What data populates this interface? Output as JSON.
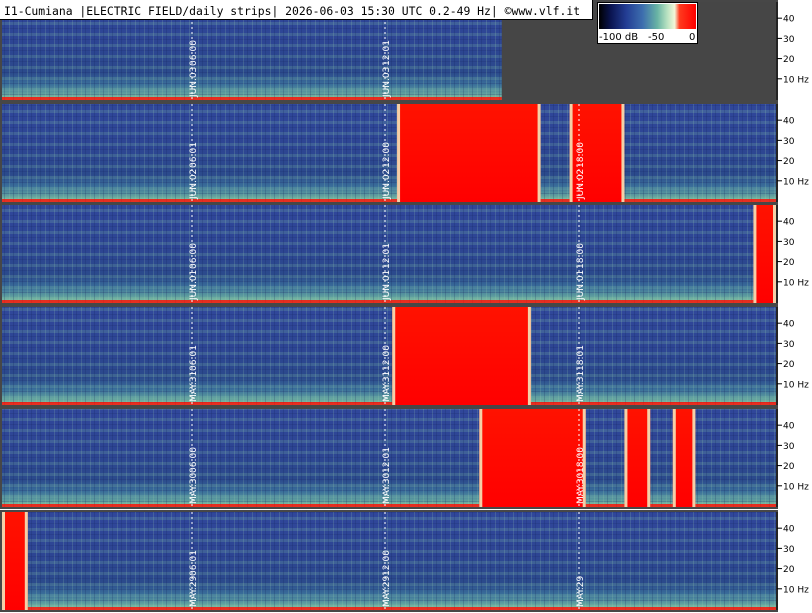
{
  "header": {
    "title": "I1-Cumiana |ELECTRIC FIELD/daily strips| 2026-06-03 15:30 UTC 0.2-49 Hz| ©www.vlf.it"
  },
  "colorbar": {
    "labels": [
      "-100 dB",
      "-50",
      "0"
    ],
    "stops": [
      "#000000",
      "#0a1450",
      "#233d94",
      "#3d6eae",
      "#68b3a4",
      "#b5e0c0",
      "#f4f7d8",
      "#ff3a1e",
      "#ff0000"
    ]
  },
  "colors": {
    "background": "#ffffff",
    "panel_empty": "#464646",
    "separator": "#474747",
    "spectro_base": "#2b3f8e",
    "saturated": "#ff0a00",
    "marker_line": "#ffffff"
  },
  "chart_data": {
    "type": "heatmap",
    "title": "I1-Cumiana |ELECTRIC FIELD/daily strips| 2026-06-03 15:30 UTC 0.2-49 Hz| ©www.vlf.it",
    "ylabel": "Hz",
    "ylim": [
      0,
      49
    ],
    "yticks": [
      "40",
      "30",
      "20",
      "10 Hz"
    ],
    "color_scale": {
      "min_db": -100,
      "max_db": 0,
      "labels": [
        "-100 dB",
        "-50",
        "0"
      ]
    },
    "strips": [
      {
        "date": "JUN.03",
        "data_end_hour": 15.5,
        "time_labels": [
          {
            "hour": 6,
            "text": "06:00"
          },
          {
            "hour": 12,
            "text": "12:01"
          }
        ],
        "date_labels": [
          {
            "hour": 6,
            "text": "JUN.03"
          },
          {
            "hour": 12,
            "text": "JUN.03"
          }
        ],
        "saturated_periods": []
      },
      {
        "date": "JUN.02",
        "data_end_hour": 24,
        "time_labels": [
          {
            "hour": 6,
            "text": "06:01"
          },
          {
            "hour": 12,
            "text": "12:00"
          },
          {
            "hour": 18,
            "text": "18:00"
          }
        ],
        "date_labels": [
          {
            "hour": 6,
            "text": "JUN.02"
          },
          {
            "hour": 12,
            "text": "JUN.02"
          },
          {
            "hour": 18,
            "text": "JUN.02"
          }
        ],
        "saturated_periods": [
          [
            12.25,
            16.7
          ],
          [
            17.6,
            19.3
          ]
        ]
      },
      {
        "date": "JUN.01",
        "data_end_hour": 24,
        "time_labels": [
          {
            "hour": 6,
            "text": "06:00"
          },
          {
            "hour": 12,
            "text": "12:01"
          },
          {
            "hour": 18,
            "text": "18:00"
          }
        ],
        "date_labels": [
          {
            "hour": 6,
            "text": "JUN.01"
          },
          {
            "hour": 12,
            "text": "JUN.01"
          },
          {
            "hour": 18,
            "text": "JUN.01"
          }
        ],
        "saturated_periods": [
          [
            23.3,
            24
          ]
        ]
      },
      {
        "date": "MAY.31",
        "data_end_hour": 24,
        "time_labels": [
          {
            "hour": 6,
            "text": "06:01"
          },
          {
            "hour": 12,
            "text": "12:00"
          },
          {
            "hour": 18,
            "text": "18:01"
          }
        ],
        "date_labels": [
          {
            "hour": 6,
            "text": "MAY.31"
          },
          {
            "hour": 12,
            "text": "MAY.31"
          },
          {
            "hour": 18,
            "text": "MAY.31"
          }
        ],
        "saturated_periods": [
          [
            12.1,
            16.4
          ]
        ]
      },
      {
        "date": "MAY.30",
        "data_end_hour": 24,
        "time_labels": [
          {
            "hour": 6,
            "text": "06:00"
          },
          {
            "hour": 12,
            "text": "12:01"
          },
          {
            "hour": 18,
            "text": "18:00"
          }
        ],
        "date_labels": [
          {
            "hour": 6,
            "text": "MAY.30"
          },
          {
            "hour": 12,
            "text": "MAY.30"
          },
          {
            "hour": 18,
            "text": "MAY.30"
          }
        ],
        "saturated_periods": [
          [
            14.8,
            18.1
          ],
          [
            19.3,
            20.1
          ],
          [
            20.8,
            21.5
          ]
        ]
      },
      {
        "date": "MAY.29",
        "data_end_hour": 24,
        "time_labels": [
          {
            "hour": 6,
            "text": "06:01"
          },
          {
            "hour": 12,
            "text": "12:00"
          }
        ],
        "date_labels": [
          {
            "hour": 6,
            "text": "MAY.29"
          },
          {
            "hour": 12,
            "text": "MAY.29"
          },
          {
            "hour": 18,
            "text": "MAY.29"
          }
        ],
        "saturated_periods": [
          [
            0,
            0.8
          ]
        ]
      }
    ]
  }
}
